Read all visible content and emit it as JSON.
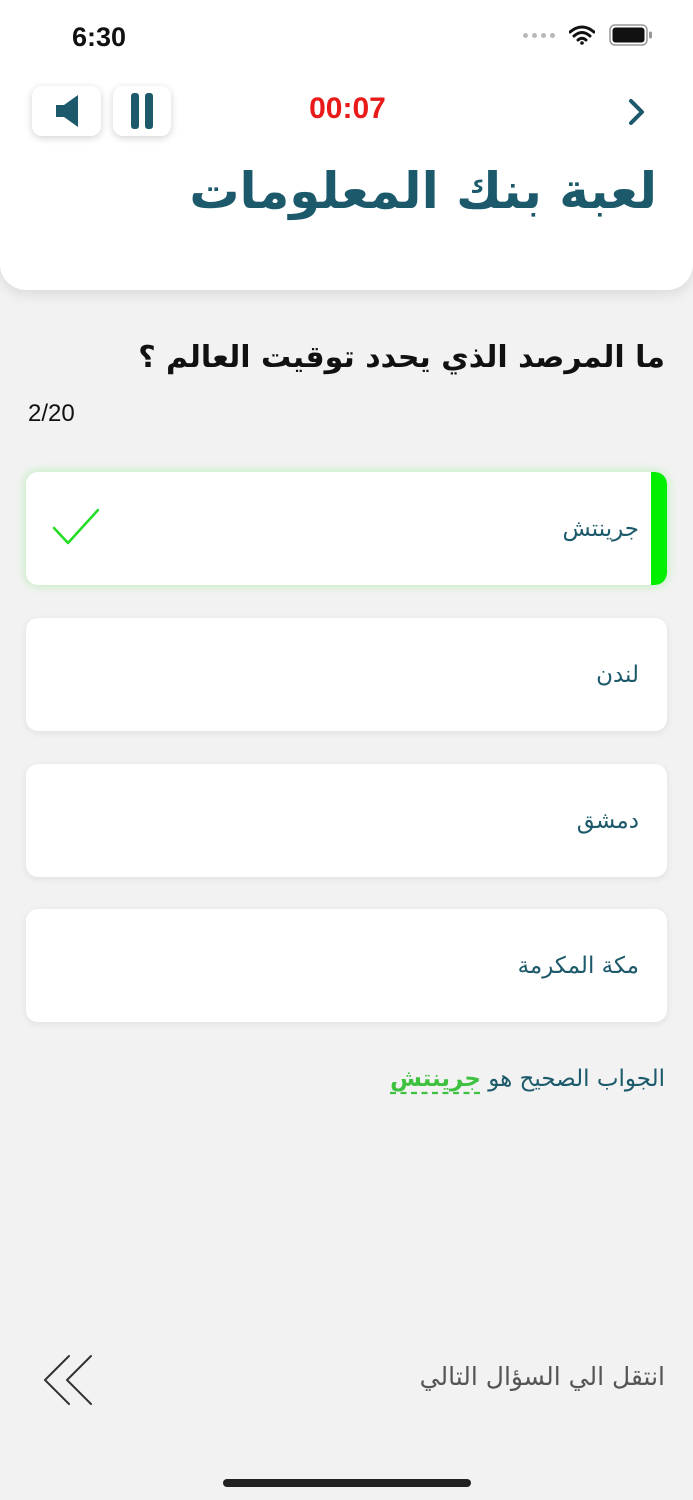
{
  "status_bar": {
    "time": "6:30"
  },
  "header": {
    "timer": "00:07",
    "title": "لعبة بنك المعلومات"
  },
  "question": {
    "text": "ما المرصد الذي يحدد توقيت العالم ؟",
    "counter": "2/20",
    "options": [
      {
        "label": "جرينتش",
        "state": "correct"
      },
      {
        "label": "لندن",
        "state": "default"
      },
      {
        "label": "دمشق",
        "state": "default"
      },
      {
        "label": "مكة المكرمة",
        "state": "default"
      }
    ]
  },
  "answer": {
    "prefix": "الجواب الصحيح هو",
    "value": "جرينتش"
  },
  "footer": {
    "next_label": "انتقل  الي السؤال التالي"
  },
  "colors": {
    "accent": "#1c5a6b",
    "timer": "#e81a1a",
    "correct": "#00ee00",
    "answer_highlight": "#3ec040",
    "background": "#f2f2f2"
  },
  "icons": [
    "speaker-icon",
    "pause-icon",
    "chevron-right-icon",
    "checkmark-icon",
    "double-chevron-left-icon",
    "wifi-icon",
    "battery-icon",
    "cellular-signal-icon"
  ]
}
